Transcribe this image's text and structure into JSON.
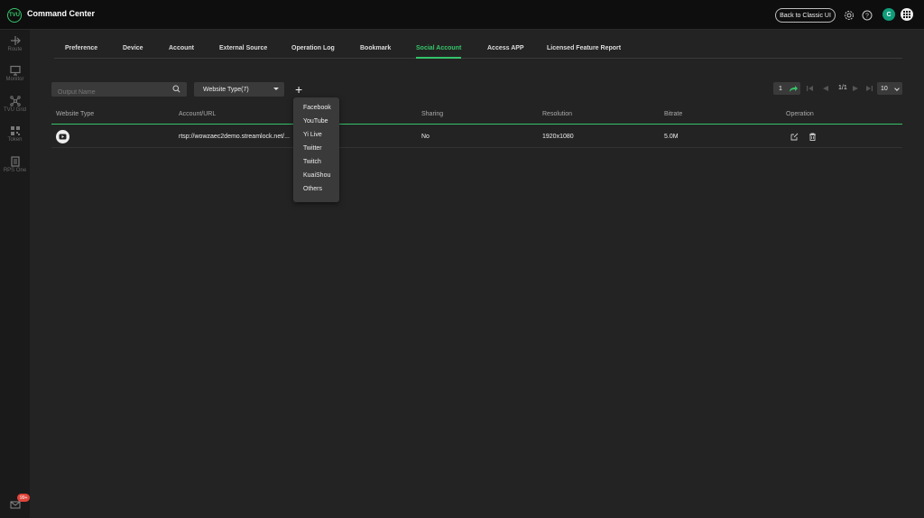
{
  "app": {
    "logo_text": "TVU",
    "title": "Command Center",
    "back_to_classic": "Back to Classic UI",
    "user_initial": "C"
  },
  "sidebar": {
    "items": [
      {
        "label": "Route",
        "icon": "route-icon"
      },
      {
        "label": "Monitor",
        "icon": "monitor-icon"
      },
      {
        "label": "TVU Grid",
        "icon": "grid-network-icon"
      },
      {
        "label": "Token",
        "icon": "qr-code-icon"
      },
      {
        "label": "RPS One",
        "icon": "document-icon"
      }
    ],
    "notification_count": "99+"
  },
  "tabs": [
    {
      "label": "Preference"
    },
    {
      "label": "Device"
    },
    {
      "label": "Account"
    },
    {
      "label": "External Source"
    },
    {
      "label": "Operation Log"
    },
    {
      "label": "Bookmark"
    },
    {
      "label": "Social Account",
      "active": true
    },
    {
      "label": "Access APP"
    },
    {
      "label": "Licensed Feature Report"
    }
  ],
  "toolbar": {
    "search_placeholder": "Output Name",
    "website_type": "Website Type(7)",
    "add_label": "+"
  },
  "dropdown": {
    "options": [
      "Facebook",
      "YouTube",
      "Yi Live",
      "Twitter",
      "Twitch",
      "KuaiShou",
      "Others"
    ]
  },
  "pagination": {
    "page_input": "1",
    "page_text": "1/1",
    "per_page": "10"
  },
  "table": {
    "headers": [
      "Website Type",
      "Account/URL",
      "Sharing",
      "Resolution",
      "Bitrate",
      "Operation"
    ],
    "rows": [
      {
        "website_icon": "youtube-icon",
        "url": "rtsp://wowzaec2demo.streamlock.net/...",
        "sharing": "No",
        "resolution": "1920x1080",
        "bitrate": "5.0M"
      }
    ]
  },
  "colors": {
    "accent": "#36c46a",
    "background": "#232323",
    "topbar": "#0e0e0e",
    "badge": "#e0443a"
  }
}
